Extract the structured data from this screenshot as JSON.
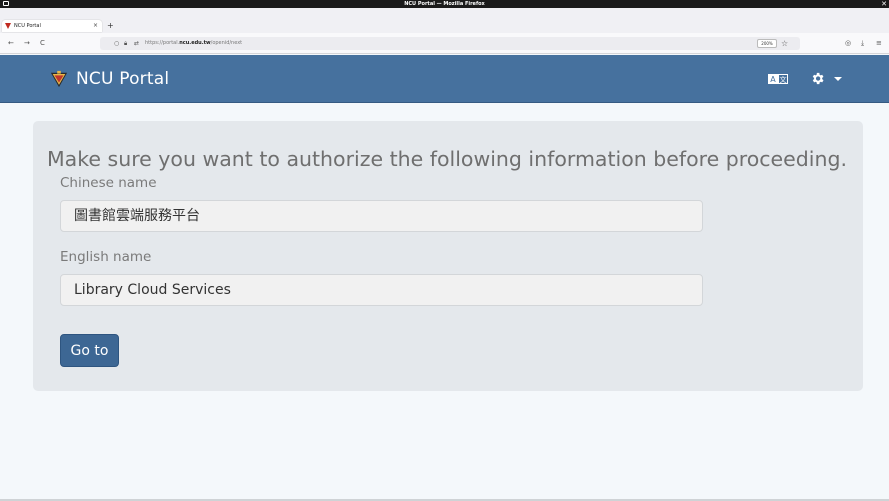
{
  "window": {
    "title": "NCU Portal — Mozilla Firefox"
  },
  "tab": {
    "label": "NCU Portal",
    "close": "×",
    "new_tab": "+"
  },
  "nav": {
    "back": "←",
    "forward": "→",
    "reload": "C",
    "url_prefix": "https://portal.",
    "url_domain": "ncu.edu.tw",
    "url_path": "/openid/next",
    "zoom": "200%",
    "bookmark_star": "☆",
    "pocket": "◎",
    "download": "⤓",
    "menu": "≡"
  },
  "header": {
    "brand": "NCU Portal",
    "colors": {
      "bar": "#46719e",
      "logo_red": "#c0362c",
      "logo_gold": "#e8b84a"
    }
  },
  "panel": {
    "heading": "Make sure you want to authorize the following information before proceeding.",
    "fields": [
      {
        "label": "Chinese name",
        "value": "圖書館雲端服務平台"
      },
      {
        "label": "English name",
        "value": "Library Cloud Services"
      }
    ],
    "submit_label": "Go to"
  },
  "icons": {
    "language": "language-icon",
    "settings": "gear-icon",
    "dropdown": "chevron-down-icon"
  }
}
